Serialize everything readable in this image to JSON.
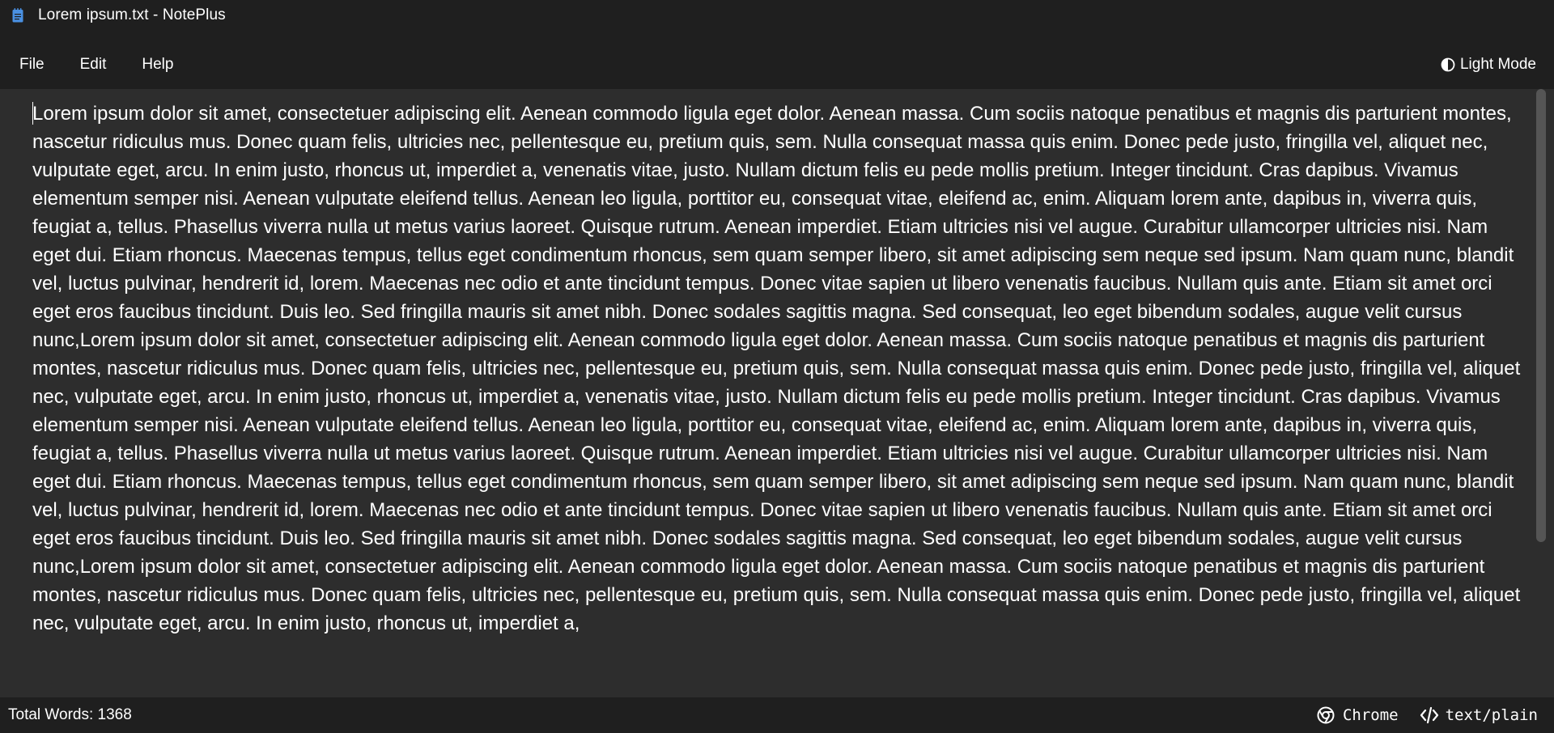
{
  "window": {
    "title": "Lorem ipsum.txt - NotePlus",
    "app_icon": "notepad-icon"
  },
  "menubar": {
    "items": [
      {
        "label": "File"
      },
      {
        "label": "Edit"
      },
      {
        "label": "Help"
      }
    ],
    "theme_toggle": {
      "label": "Light Mode",
      "icon": "contrast-icon"
    }
  },
  "editor": {
    "content": "Lorem ipsum dolor sit amet, consectetuer adipiscing elit. Aenean commodo ligula eget dolor. Aenean massa. Cum sociis natoque penatibus et magnis dis parturient montes, nascetur ridiculus mus. Donec quam felis, ultricies nec, pellentesque eu, pretium quis, sem. Nulla consequat massa quis enim. Donec pede justo, fringilla vel, aliquet nec, vulputate eget, arcu. In enim justo, rhoncus ut, imperdiet a, venenatis vitae, justo. Nullam dictum felis eu pede mollis pretium. Integer tincidunt. Cras dapibus. Vivamus elementum semper nisi. Aenean vulputate eleifend tellus. Aenean leo ligula, porttitor eu, consequat vitae, eleifend ac, enim. Aliquam lorem ante, dapibus in, viverra quis, feugiat a, tellus. Phasellus viverra nulla ut metus varius laoreet. Quisque rutrum. Aenean imperdiet. Etiam ultricies nisi vel augue. Curabitur ullamcorper ultricies nisi. Nam eget dui. Etiam rhoncus. Maecenas tempus, tellus eget condimentum rhoncus, sem quam semper libero, sit amet adipiscing sem neque sed ipsum. Nam quam nunc, blandit vel, luctus pulvinar, hendrerit id, lorem. Maecenas nec odio et ante tincidunt tempus. Donec vitae sapien ut libero venenatis faucibus. Nullam quis ante. Etiam sit amet orci eget eros faucibus tincidunt. Duis leo. Sed fringilla mauris sit amet nibh. Donec sodales sagittis magna. Sed consequat, leo eget bibendum sodales, augue velit cursus nunc,Lorem ipsum dolor sit amet, consectetuer adipiscing elit. Aenean commodo ligula eget dolor. Aenean massa. Cum sociis natoque penatibus et magnis dis parturient montes, nascetur ridiculus mus. Donec quam felis, ultricies nec, pellentesque eu, pretium quis, sem. Nulla consequat massa quis enim. Donec pede justo, fringilla vel, aliquet nec, vulputate eget, arcu. In enim justo, rhoncus ut, imperdiet a, venenatis vitae, justo. Nullam dictum felis eu pede mollis pretium. Integer tincidunt. Cras dapibus. Vivamus elementum semper nisi. Aenean vulputate eleifend tellus. Aenean leo ligula, porttitor eu, consequat vitae, eleifend ac, enim. Aliquam lorem ante, dapibus in, viverra quis, feugiat a, tellus. Phasellus viverra nulla ut metus varius laoreet. Quisque rutrum. Aenean imperdiet. Etiam ultricies nisi vel augue. Curabitur ullamcorper ultricies nisi. Nam eget dui. Etiam rhoncus. Maecenas tempus, tellus eget condimentum rhoncus, sem quam semper libero, sit amet adipiscing sem neque sed ipsum. Nam quam nunc, blandit vel, luctus pulvinar, hendrerit id, lorem. Maecenas nec odio et ante tincidunt tempus. Donec vitae sapien ut libero venenatis faucibus. Nullam quis ante. Etiam sit amet orci eget eros faucibus tincidunt. Duis leo. Sed fringilla mauris sit amet nibh. Donec sodales sagittis magna. Sed consequat, leo eget bibendum sodales, augue velit cursus nunc,Lorem ipsum dolor sit amet, consectetuer adipiscing elit. Aenean commodo ligula eget dolor. Aenean massa. Cum sociis natoque penatibus et magnis dis parturient montes, nascetur ridiculus mus. Donec quam felis, ultricies nec, pellentesque eu, pretium quis, sem. Nulla consequat massa quis enim. Donec pede justo, fringilla vel, aliquet nec, vulputate eget, arcu. In enim justo, rhoncus ut, imperdiet a,"
  },
  "statusbar": {
    "word_count": "Total Words: 1368",
    "browser": {
      "label": "Chrome",
      "icon": "chrome-icon"
    },
    "mime": {
      "label": "text/plain",
      "icon": "code-icon"
    }
  },
  "colors": {
    "chrome_bg": "#1f1f1f",
    "editor_bg": "#2d2d2d",
    "text": "#ffffff",
    "scrollbar": "#555555",
    "app_icon_blue": "#4a90e2"
  }
}
